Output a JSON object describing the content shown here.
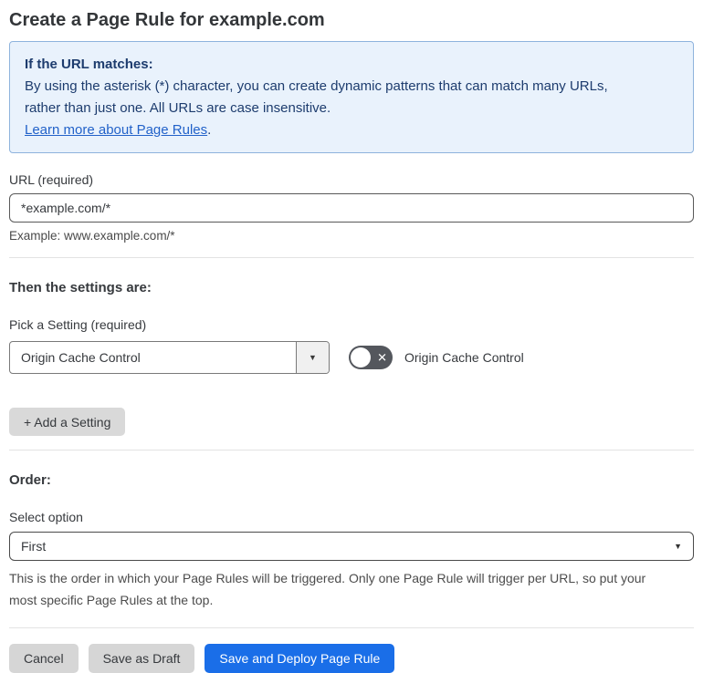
{
  "page": {
    "title": "Create a Page Rule for example.com"
  },
  "info_box": {
    "heading": "If the URL matches:",
    "body_line1": "By using the asterisk (*) character, you can create dynamic patterns that can match many URLs,",
    "body_line2": "rather than just one. All URLs are case insensitive.",
    "link_label": "Learn more about Page Rules",
    "link_suffix": "."
  },
  "url_field": {
    "label": "URL (required)",
    "value": "*example.com/*",
    "example": "Example: www.example.com/*"
  },
  "settings": {
    "heading": "Then the settings are:",
    "picker_label": "Pick a Setting (required)",
    "picker_value": "Origin Cache Control",
    "toggle_label": "Origin Cache Control",
    "toggle_state": "off",
    "add_button_label": "+ Add a Setting"
  },
  "order": {
    "heading": "Order:",
    "select_label": "Select option",
    "select_value": "First",
    "help_line1": "This is the order in which your Page Rules will be triggered. Only one Page Rule will trigger per URL, so put your",
    "help_line2": "most specific Page Rules at the top."
  },
  "actions": {
    "cancel": "Cancel",
    "save_draft": "Save as Draft",
    "save_deploy": "Save and Deploy Page Rule"
  },
  "icons": {
    "dropdown_arrow": "▼",
    "toggle_x": "✕"
  },
  "colors": {
    "info_bg": "#e9f2fc",
    "info_border": "#8eb3dd",
    "info_text": "#1d3c6e",
    "link": "#2262c9",
    "primary_button": "#1a6ee8",
    "secondary_button": "#d6d6d6",
    "toggle_off": "#54575d",
    "text": "#36393d"
  }
}
